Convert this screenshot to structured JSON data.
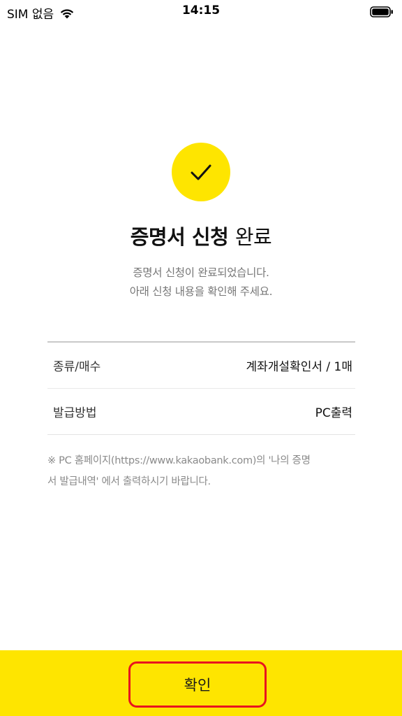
{
  "status_bar": {
    "carrier": "SIM 없음",
    "time": "14:15"
  },
  "result": {
    "title_strong": "증명서 신청",
    "title_light": "완료",
    "description_line1": "증명서 신청이 완료되었습니다.",
    "description_line2": "아래 신청 내용을 확인해 주세요."
  },
  "details": [
    {
      "label": "종류/매수",
      "value": "계좌개설확인서 / 1매"
    },
    {
      "label": "발급방법",
      "value": "PC출력"
    }
  ],
  "note_line1": "※ PC 홈페이지(https://www.kakaobank.com)의 '나의 증명",
  "note_line2": "서 발급내역' 에서 출력하시기 바랍니다.",
  "confirm_button_label": "확인",
  "colors": {
    "accent_yellow": "#fee500",
    "highlight_red": "#e8141f"
  },
  "icons": [
    "wifi-icon",
    "battery-icon",
    "check-icon"
  ]
}
